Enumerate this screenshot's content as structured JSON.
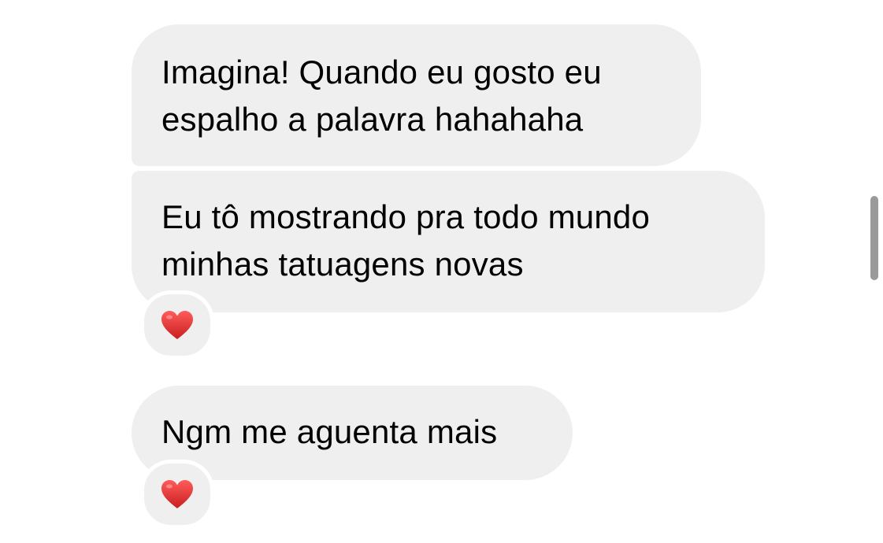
{
  "messages": [
    {
      "lines": [
        "Imagina! Quando eu gosto eu",
        "espalho a palavra hahahaha"
      ],
      "reaction": null
    },
    {
      "lines": [
        "Eu tô mostrando pra todo mundo",
        "minhas tatuagens novas"
      ],
      "reaction": "heart-icon"
    },
    {
      "lines": [
        "Ngm me aguenta mais"
      ],
      "reaction": "heart-icon"
    }
  ],
  "colors": {
    "bubble_background": "#efefef",
    "heart": "#e02a2a",
    "scrollbar": "#9a9a9a"
  }
}
